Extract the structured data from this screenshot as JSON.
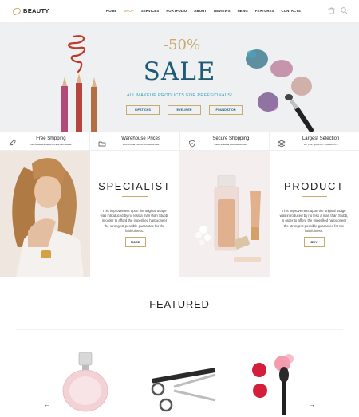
{
  "header": {
    "logo_text": "BEAUTY",
    "nav": [
      {
        "label": "HOME",
        "active": false
      },
      {
        "label": "SHOP",
        "active": true
      },
      {
        "label": "SERVICES",
        "active": false
      },
      {
        "label": "PORTFOLIO",
        "active": false
      },
      {
        "label": "ABOUT",
        "active": false
      },
      {
        "label": "REVIEWS",
        "active": false
      },
      {
        "label": "NEWS",
        "active": false
      },
      {
        "label": "FEATURES",
        "active": false
      },
      {
        "label": "CONTACTS",
        "active": false
      }
    ],
    "icons": [
      "cart-icon",
      "search-icon"
    ]
  },
  "hero": {
    "percent": "-50%",
    "title": "SALE",
    "subtitle": "ALL MAKEUP PRODUCTS FOR PRFESIONALS!",
    "buttons": [
      "LIPSTICKS",
      "EYELINER",
      "FOUNDATION"
    ]
  },
  "features": [
    {
      "icon": "rocket-icon",
      "title": "Free Shipping",
      "subtitle": "ON ORDERS WORTH $50 OR MORE"
    },
    {
      "icon": "folder-icon",
      "title": "Warehouse Prices",
      "subtitle": "WITH LOW PRICE GUARANTEE"
    },
    {
      "icon": "shield-icon",
      "title": "Secure Shopping",
      "subtitle": "CERTIFIED BY AUTHORITIES"
    },
    {
      "icon": "layers-icon",
      "title": "Largest Selection",
      "subtitle": "OF TOP QUALITY PRODUCTS"
    }
  ],
  "specialist": {
    "title": "SPECIALIST",
    "text": "This improvement upon the original usage was introduced by no less a man than Stubb, in order to afford the imperilled harpooneer the strongest possible guarantee for the faithfulness.",
    "button": "MORE"
  },
  "product": {
    "title": "PRODUCT",
    "text": "This improvement upon the original usage was introduced by no less a man than Stubb, in order to afford the imperilled harpooneer the strongest possible guarantee for the faithfulness.",
    "button": "BUY"
  },
  "featured": {
    "title": "FEATURED",
    "items": [
      "perfume-bottle",
      "scissors",
      "nail-polish-brush"
    ]
  },
  "colors": {
    "accent": "#c9a96e",
    "sale_blue": "#1f5b73",
    "hero_bg": "#eef0f2"
  }
}
